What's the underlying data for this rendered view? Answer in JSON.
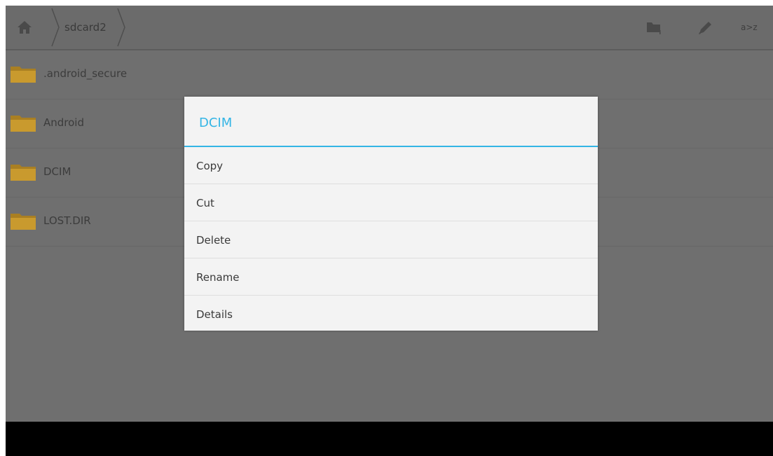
{
  "action_bar": {
    "breadcrumb": "sdcard2",
    "sort_label": "a>z",
    "icons": [
      "home-icon",
      "new-folder-icon",
      "edit-icon"
    ]
  },
  "files": [
    {
      "name": ".android_secure",
      "icon": "folder-icon"
    },
    {
      "name": "Android",
      "icon": "folder-icon"
    },
    {
      "name": "DCIM",
      "icon": "folder-icon"
    },
    {
      "name": "LOST.DIR",
      "icon": "folder-icon"
    }
  ],
  "dialog": {
    "title": "DCIM",
    "items": [
      "Copy",
      "Cut",
      "Delete",
      "Rename",
      "Details"
    ]
  },
  "colors": {
    "accent": "#33b5e5",
    "dim_background": "#6f6f6f",
    "dialog_background": "#f3f3f3",
    "nav_bar": "#000000",
    "folder": "#c99a2e"
  }
}
